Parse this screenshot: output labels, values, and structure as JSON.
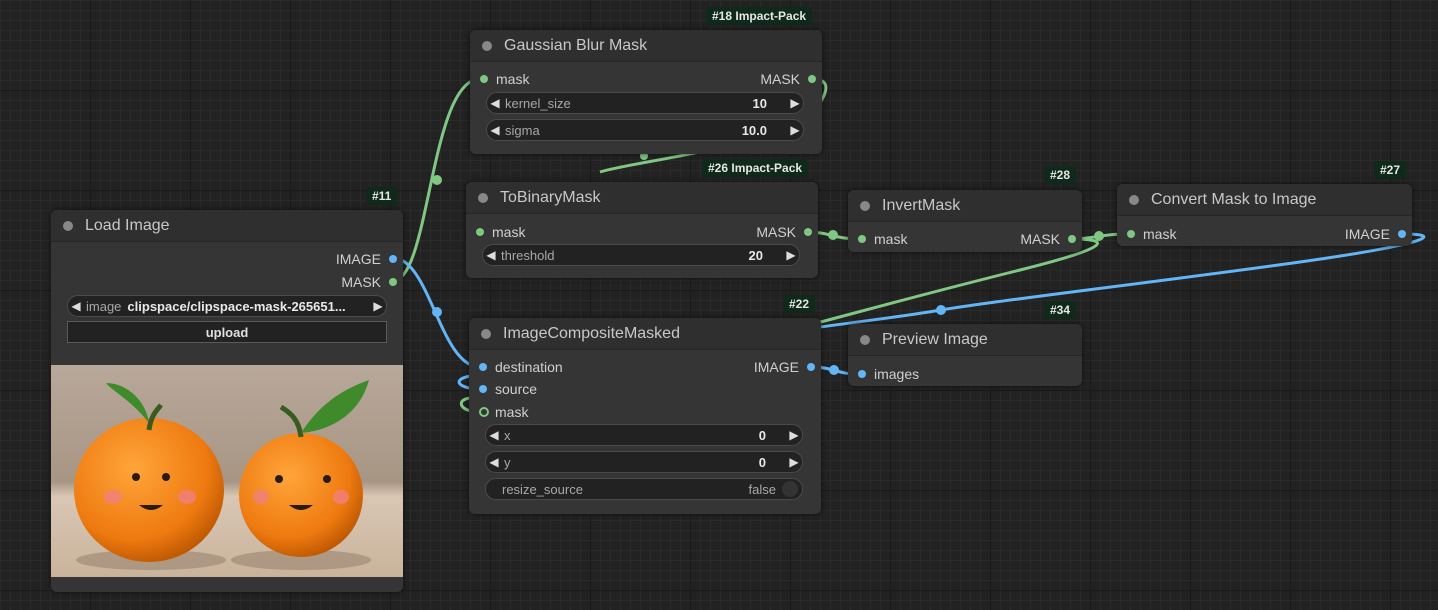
{
  "colors": {
    "mask_link": "#81c784",
    "image_link": "#64b5f6",
    "canvas_bg": "#222222",
    "node_bg": "#353535",
    "badge_bg": "#0f2a1a"
  },
  "nodes": {
    "load_image": {
      "badge": "#11",
      "title": "Load Image",
      "outputs": [
        "IMAGE",
        "MASK"
      ],
      "image_widget": {
        "label": "image",
        "value": "clipspace/clipspace-mask-265651..."
      },
      "upload_label": "upload",
      "preview_alt": "two smiling clay oranges"
    },
    "gaussian_blur": {
      "badge": "#18 Impact-Pack",
      "title": "Gaussian Blur Mask",
      "input": "mask",
      "output": "MASK",
      "kernel_size": {
        "label": "kernel_size",
        "value": "10"
      },
      "sigma": {
        "label": "sigma",
        "value": "10.0"
      }
    },
    "to_binary": {
      "badge": "#26 Impact-Pack",
      "title": "ToBinaryMask",
      "input": "mask",
      "output": "MASK",
      "threshold": {
        "label": "threshold",
        "value": "20"
      }
    },
    "invert_mask": {
      "badge": "#28",
      "title": "InvertMask",
      "input": "mask",
      "output": "MASK"
    },
    "convert_mask": {
      "badge": "#27",
      "title": "Convert Mask to Image",
      "input": "mask",
      "output": "IMAGE"
    },
    "composite": {
      "badge": "#22",
      "title": "ImageCompositeMasked",
      "inputs": [
        "destination",
        "source",
        "mask"
      ],
      "output": "IMAGE",
      "x": {
        "label": "x",
        "value": "0"
      },
      "y": {
        "label": "y",
        "value": "0"
      },
      "resize_source": {
        "label": "resize_source",
        "value": "false"
      }
    },
    "preview": {
      "badge": "#34",
      "title": "Preview Image",
      "input": "images"
    }
  },
  "icons": {
    "arrow_left": "◀",
    "arrow_right": "▶"
  }
}
